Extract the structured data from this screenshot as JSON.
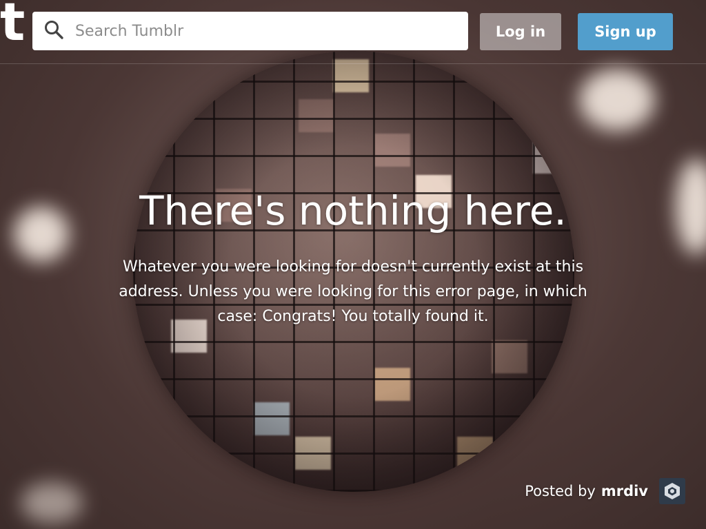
{
  "header": {
    "logo": "t",
    "search": {
      "placeholder": "Search Tumblr",
      "value": ""
    },
    "login_label": "Log in",
    "signup_label": "Sign up"
  },
  "main": {
    "title": "There's nothing here.",
    "message": "Whatever you were looking for doesn't currently exist at this address. Unless you were looking for this error page, in which case: Congrats! You totally found it."
  },
  "credit": {
    "prefix": "Posted by",
    "author": "mrdiv"
  },
  "colors": {
    "signup": "#529ecc",
    "login": "rgba(255,255,255,0.45)",
    "text": "#ffffff"
  },
  "icons": {
    "search": "search-icon",
    "avatar": "avatar-icon"
  }
}
